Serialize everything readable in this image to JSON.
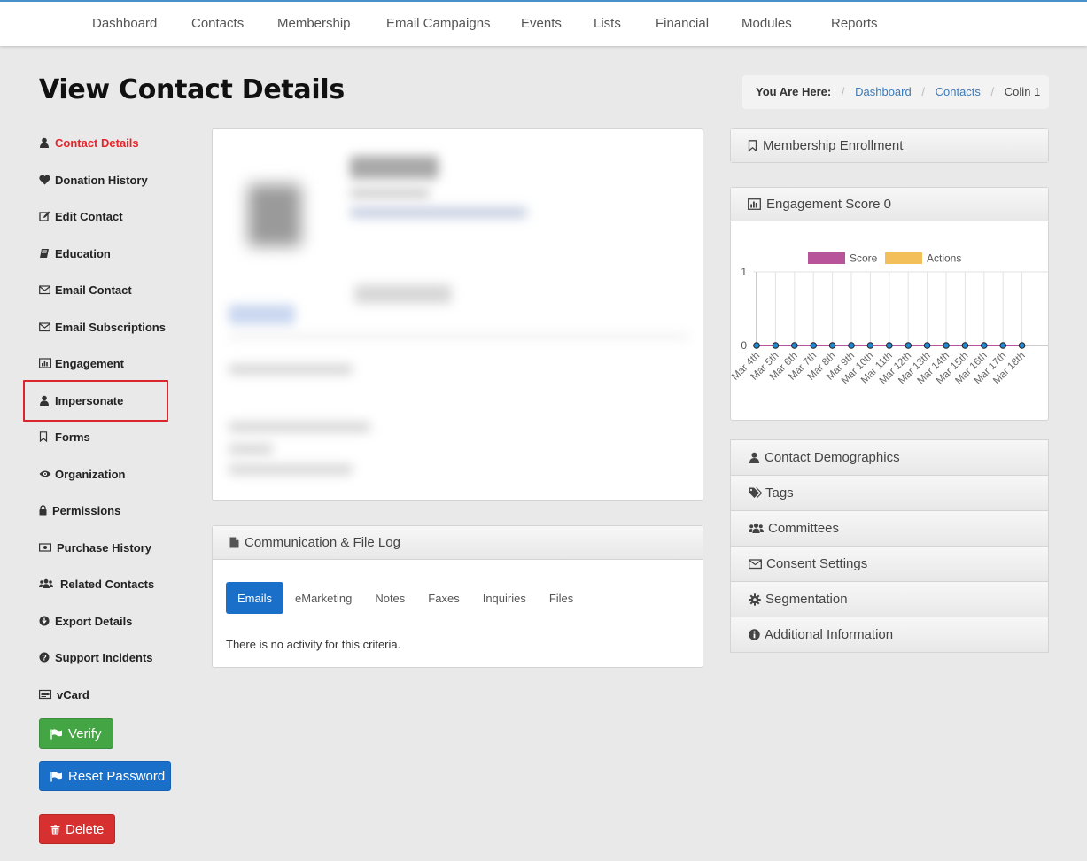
{
  "nav": {
    "items": [
      "Dashboard",
      "Contacts",
      "Membership",
      "Email Campaigns",
      "Events",
      "Lists",
      "Financial",
      "Modules",
      "Reports"
    ]
  },
  "page": {
    "title": "View Contact Details"
  },
  "breadcrumb": {
    "label": "You Are Here:",
    "items": [
      "Dashboard",
      "Contacts"
    ],
    "current": "Colin 1"
  },
  "sidebar": {
    "items": [
      {
        "label": "Contact Details",
        "icon": "user-icon",
        "active": true
      },
      {
        "label": "Donation History",
        "icon": "heart-icon"
      },
      {
        "label": "Edit Contact",
        "icon": "edit-icon"
      },
      {
        "label": "Education",
        "icon": "book-icon"
      },
      {
        "label": "Email Contact",
        "icon": "envelope-icon"
      },
      {
        "label": "Email Subscriptions",
        "icon": "envelope-icon"
      },
      {
        "label": "Engagement",
        "icon": "bar-chart-icon"
      },
      {
        "label": "Impersonate",
        "icon": "user-icon",
        "highlighted": true
      },
      {
        "label": "Forms",
        "icon": "bookmark-icon"
      },
      {
        "label": "Organization",
        "icon": "eye-icon"
      },
      {
        "label": "Permissions",
        "icon": "lock-icon"
      },
      {
        "label": "Purchase History",
        "icon": "money-icon"
      },
      {
        "label": "Related Contacts",
        "icon": "users-icon"
      },
      {
        "label": "Export Details",
        "icon": "download-icon"
      },
      {
        "label": "Support Incidents",
        "icon": "question-icon"
      },
      {
        "label": "vCard",
        "icon": "vcard-icon"
      }
    ],
    "verify_label": "Verify",
    "reset_label": "Reset Password",
    "delete_label": "Delete"
  },
  "comm_log": {
    "title": "Communication & File Log",
    "tabs": [
      "Emails",
      "eMarketing",
      "Notes",
      "Faxes",
      "Inquiries",
      "Files"
    ],
    "active_tab": "Emails",
    "empty_text": "There is no activity for this criteria."
  },
  "right": {
    "membership_title": "Membership Enrollment",
    "engagement_title": "Engagement Score 0",
    "sections": [
      "Contact Demographics",
      "Tags",
      "Committees",
      "Consent Settings",
      "Segmentation",
      "Additional Information"
    ]
  },
  "colors": {
    "accent": "#1a6fc9",
    "active_menu": "#e8232a",
    "score": "#b8559a",
    "actions": "#f2bf5a",
    "highlight": "#d9262c"
  },
  "chart_data": {
    "type": "line",
    "categories": [
      "Mar 4th",
      "Mar 5th",
      "Mar 6th",
      "Mar 7th",
      "Mar 8th",
      "Mar 9th",
      "Mar 10th",
      "Mar 11th",
      "Mar 12th",
      "Mar 13th",
      "Mar 14th",
      "Mar 15th",
      "Mar 16th",
      "Mar 17th",
      "Mar 18th"
    ],
    "series": [
      {
        "name": "Score",
        "values": [
          0,
          0,
          0,
          0,
          0,
          0,
          0,
          0,
          0,
          0,
          0,
          0,
          0,
          0,
          0
        ]
      },
      {
        "name": "Actions",
        "values": [
          0,
          0,
          0,
          0,
          0,
          0,
          0,
          0,
          0,
          0,
          0,
          0,
          0,
          0,
          0
        ]
      }
    ],
    "ylim": [
      0,
      1
    ],
    "yticks": [
      "0",
      "1"
    ],
    "legend": "top",
    "grid": true
  }
}
